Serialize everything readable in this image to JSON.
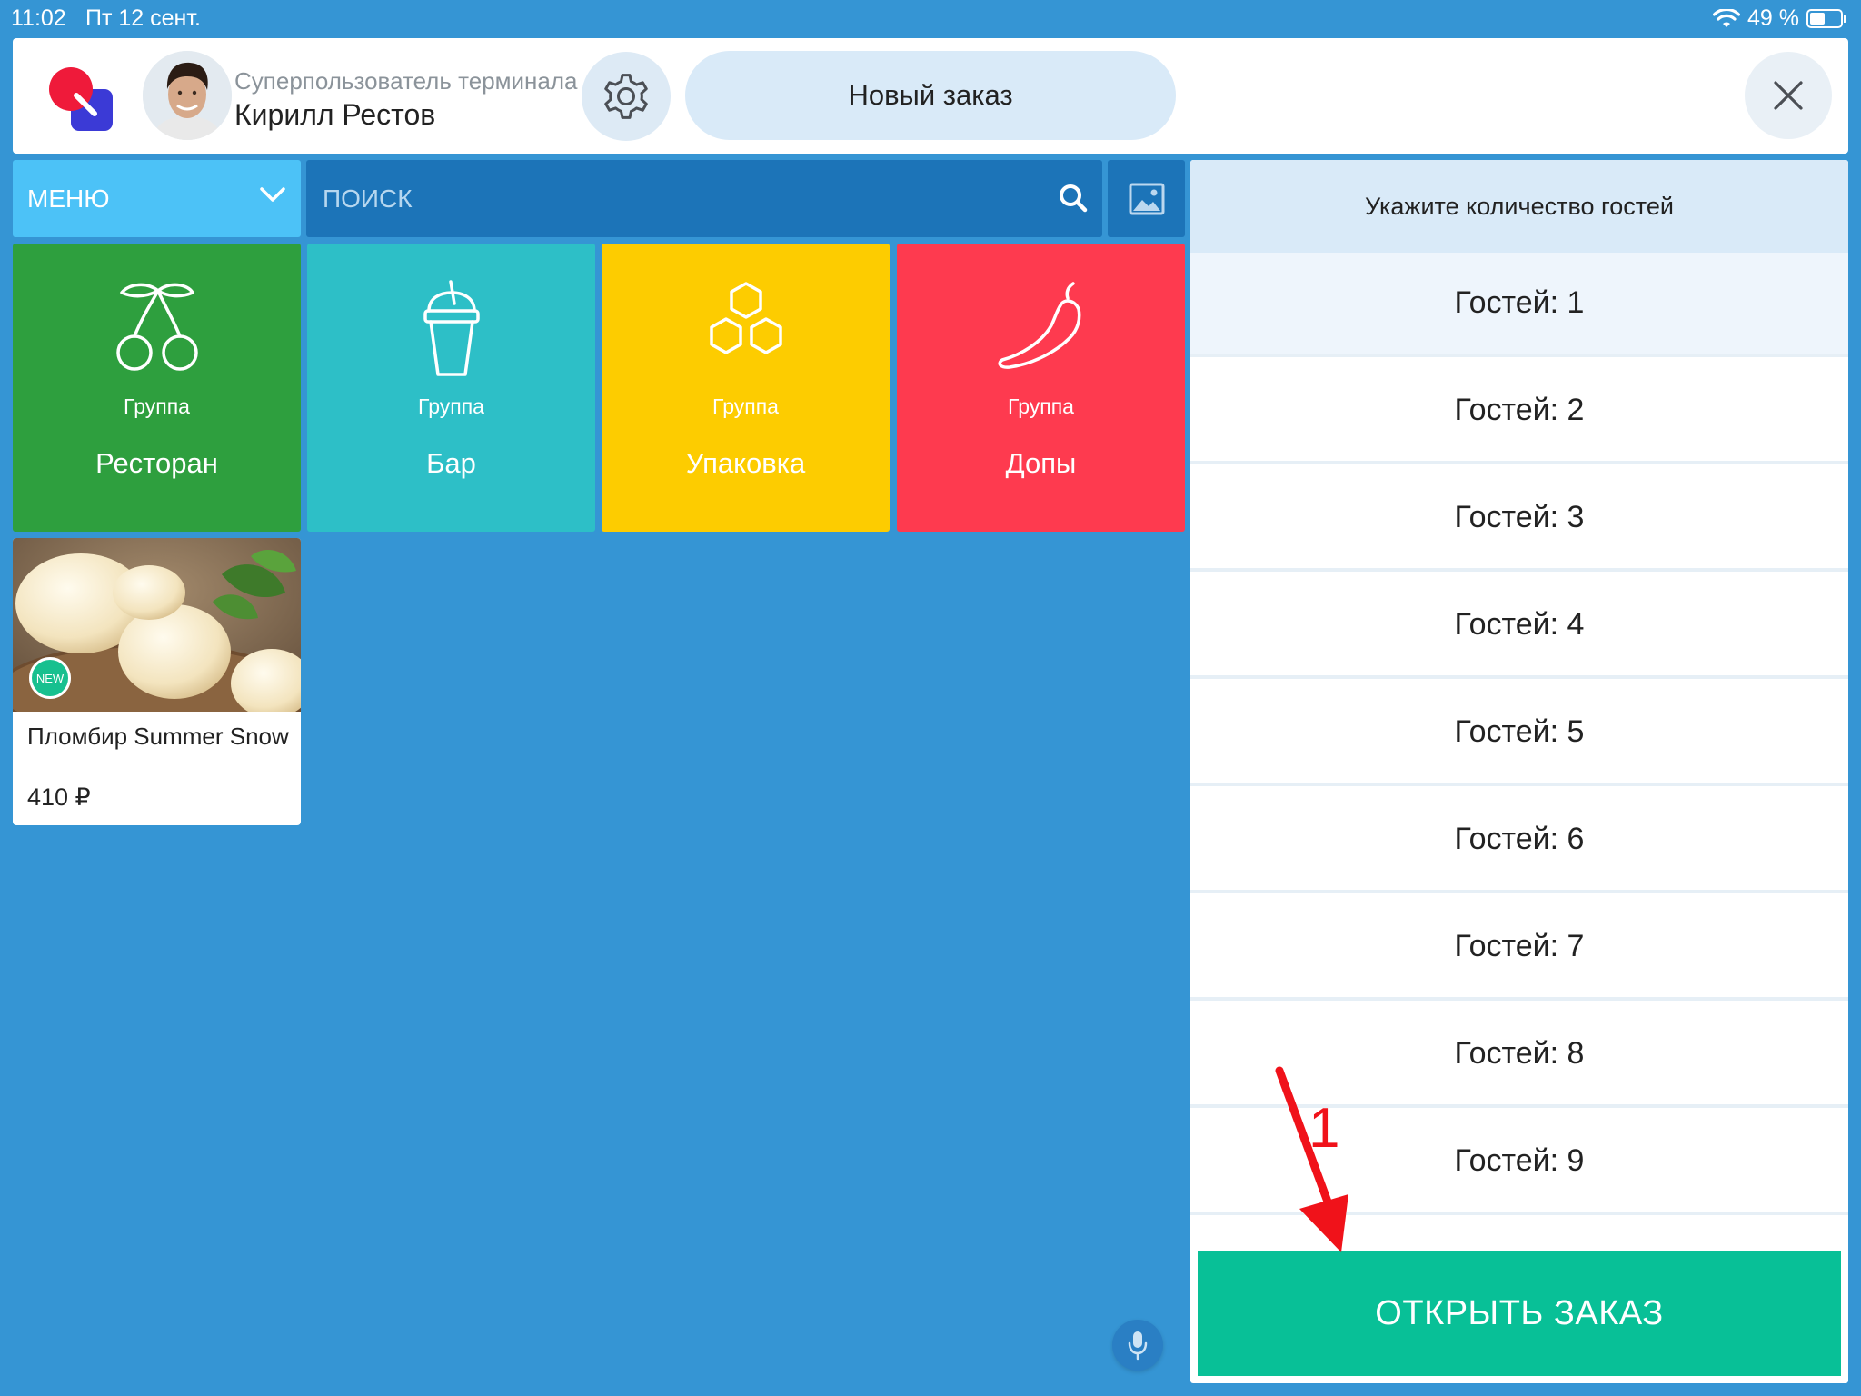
{
  "status_bar": {
    "time": "11:02",
    "date": "Пт 12 сент.",
    "battery": "49 %",
    "battery_level": 0.49
  },
  "header": {
    "user_role": "Суперпользователь терминала",
    "user_name": "Кирилл Рестов",
    "order_tab": "Новый заказ"
  },
  "toolbar": {
    "menu_label": "МЕНЮ",
    "search_placeholder": "ПОИСК"
  },
  "groups": [
    {
      "sub": "Группа",
      "name": "Ресторан",
      "color": "#2e9f3e",
      "icon": "cherry-icon"
    },
    {
      "sub": "Группа",
      "name": "Бар",
      "color": "#2dbfc7",
      "icon": "drink-cup-icon"
    },
    {
      "sub": "Группа",
      "name": "Упаковка",
      "color": "#fdcc00",
      "icon": "hexagon-cells-icon"
    },
    {
      "sub": "Группа",
      "name": "Допы",
      "color": "#fe3a4f",
      "icon": "chili-pepper-icon"
    }
  ],
  "products": [
    {
      "name": "Пломбир Summer Snow",
      "price": "410 ₽",
      "badge": "NEW"
    }
  ],
  "guests_panel": {
    "title": "Укажите количество гостей",
    "options": [
      "Гостей: 1",
      "Гостей: 2",
      "Гостей: 3",
      "Гостей: 4",
      "Гостей: 5",
      "Гостей: 6",
      "Гостей: 7",
      "Гостей: 8",
      "Гостей: 9"
    ],
    "selected_index": 0,
    "open_button": "ОТКРЫТЬ ЗАКАЗ"
  },
  "annotation": {
    "label": "1",
    "color": "#f0121a"
  },
  "colors": {
    "background": "#3595d4",
    "accent_green": "#08c097",
    "menu_blue": "#4cc2f7",
    "search_blue": "#1c74b8"
  }
}
